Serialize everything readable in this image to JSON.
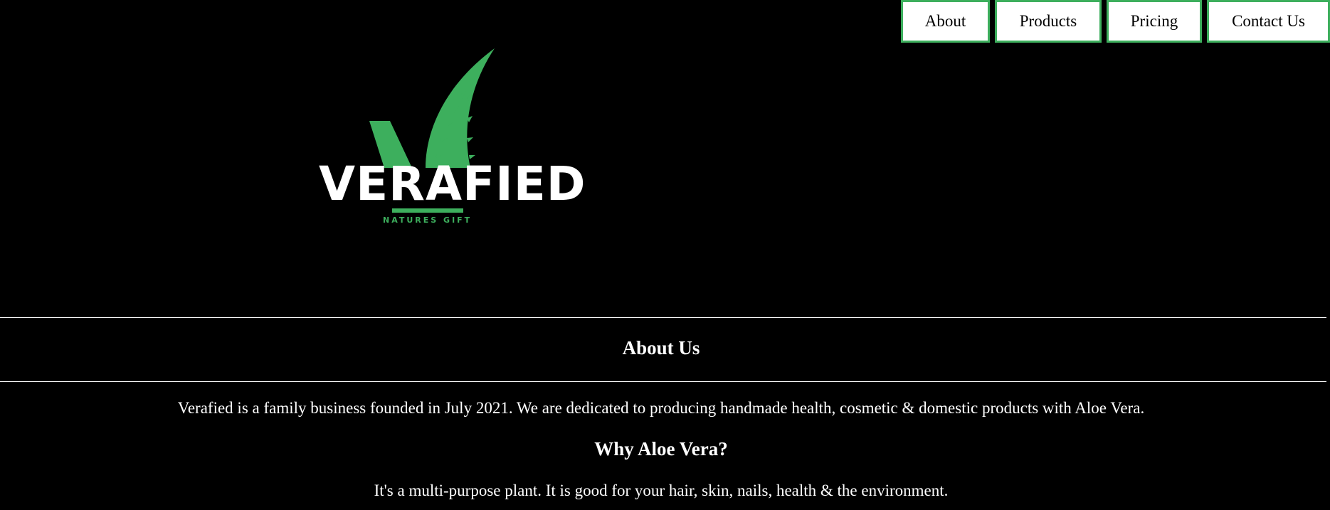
{
  "nav": {
    "items": [
      {
        "label": "About"
      },
      {
        "label": "Products"
      },
      {
        "label": "Pricing"
      },
      {
        "label": "Contact Us"
      }
    ]
  },
  "logo": {
    "wordmark": "VERAFIED",
    "tagline": "NATURES GIFT"
  },
  "about": {
    "heading": "About Us",
    "intro": "Verafied is a family business founded in July 2021. We are dedicated to producing handmade health, cosmetic & domestic products with Aloe Vera."
  },
  "why": {
    "heading": "Why Aloe Vera?",
    "text": "It's a multi-purpose plant. It is good for your hair, skin, nails, health & the environment."
  },
  "colors": {
    "background": "#000000",
    "accent": "#3daf5d",
    "text": "#ffffff"
  }
}
